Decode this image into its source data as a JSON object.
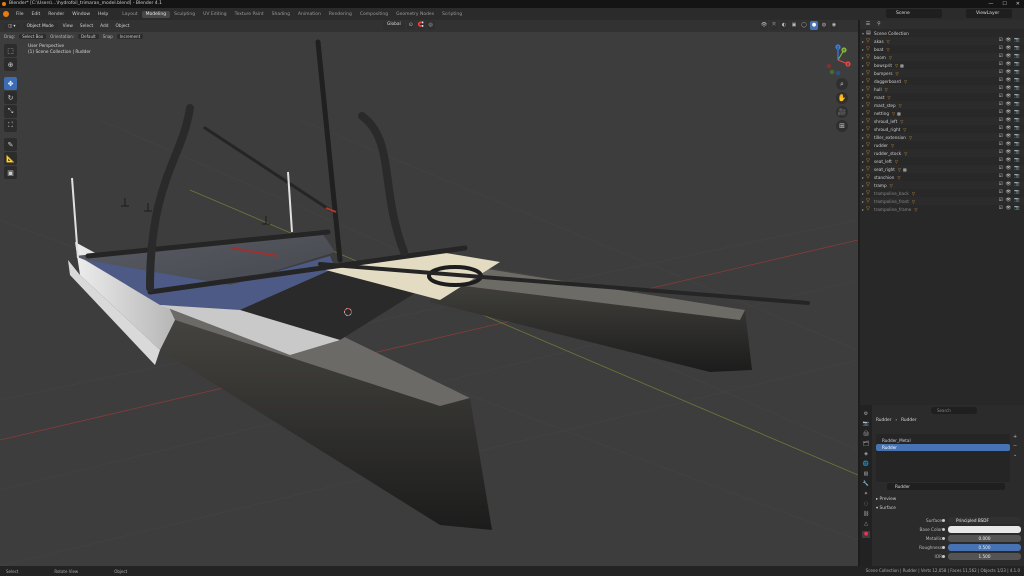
{
  "window": {
    "title": "Blender* [C:\\Users\\...\\hydrofoil_trimaran_model.blend] - Blender 4.1",
    "controls": [
      "—",
      "☐",
      "✕"
    ]
  },
  "topbar": {
    "menus": [
      "File",
      "Edit",
      "Render",
      "Window",
      "Help"
    ],
    "workspaces": [
      "Layout",
      "Modeling",
      "Sculpting",
      "UV Editing",
      "Texture Paint",
      "Shading",
      "Animation",
      "Rendering",
      "Compositing",
      "Geometry Nodes",
      "Scripting"
    ],
    "active_workspace": "Modeling",
    "scene": "Scene",
    "view_layer": "ViewLayer"
  },
  "viewport": {
    "mode": "Object Mode",
    "menus": [
      "View",
      "Select",
      "Add",
      "Object"
    ],
    "transform_orientation": "Global",
    "tool_settings": {
      "label_drag": "Drag:",
      "drag_value": "Select Box",
      "label_orient": "Orientation:",
      "orient_value": "Default",
      "label_snap": "Snap",
      "snap_value": "Increment"
    },
    "overlay_line1": "User Perspective",
    "overlay_line2": "(1) Scene Collection | Rudder",
    "gizmo_axes": [
      "X",
      "Y",
      "Z"
    ]
  },
  "outliner": {
    "root": "Scene Collection",
    "items": [
      {
        "name": "akas",
        "has_mat": false,
        "dim": false
      },
      {
        "name": "boat",
        "has_mat": false,
        "dim": false
      },
      {
        "name": "boom",
        "has_mat": false,
        "dim": false
      },
      {
        "name": "bowsprit",
        "has_mat": true,
        "dim": false
      },
      {
        "name": "bumpers",
        "has_mat": false,
        "dim": false
      },
      {
        "name": "daggerboard",
        "has_mat": false,
        "dim": false
      },
      {
        "name": "hull",
        "has_mat": false,
        "dim": false
      },
      {
        "name": "mast",
        "has_mat": false,
        "dim": false
      },
      {
        "name": "mast_step",
        "has_mat": false,
        "dim": false
      },
      {
        "name": "netting",
        "has_mat": true,
        "dim": false
      },
      {
        "name": "shroud_left",
        "has_mat": false,
        "dim": false
      },
      {
        "name": "shroud_right",
        "has_mat": false,
        "dim": false
      },
      {
        "name": "tiller_extension",
        "has_mat": false,
        "dim": false
      },
      {
        "name": "rudder",
        "has_mat": false,
        "dim": false
      },
      {
        "name": "rudder_stock",
        "has_mat": false,
        "dim": false
      },
      {
        "name": "seat_left",
        "has_mat": false,
        "dim": false
      },
      {
        "name": "seat_right",
        "has_mat": true,
        "dim": false
      },
      {
        "name": "stanchion",
        "has_mat": false,
        "dim": false
      },
      {
        "name": "tramp",
        "has_mat": false,
        "dim": false
      },
      {
        "name": "trampoline_back",
        "has_mat": false,
        "dim": true
      },
      {
        "name": "trampoline_front",
        "has_mat": false,
        "dim": true
      },
      {
        "name": "trampoline_frame",
        "has_mat": false,
        "dim": true
      }
    ]
  },
  "properties": {
    "search_placeholder": "Search",
    "breadcrumb": [
      "Rudder",
      "Rudder"
    ],
    "material_slots": [
      {
        "name": "Rudder_Metal",
        "active": false
      },
      {
        "name": "Rudder",
        "active": true
      }
    ],
    "material_name": "Rudder",
    "panels": {
      "preview": "Preview",
      "surface": "Surface"
    },
    "fields": [
      {
        "label": "Surface",
        "value": "Principled BSDF",
        "style": "dark"
      },
      {
        "label": "Base Color",
        "value": "",
        "style": "white"
      },
      {
        "label": "Metallic",
        "value": "0.000",
        "style": "grey"
      },
      {
        "label": "Roughness",
        "value": "0.500",
        "style": "blue"
      },
      {
        "label": "IOR",
        "value": "1.500",
        "style": "grey"
      }
    ]
  },
  "statusbar": {
    "items": [
      "Select",
      "Rotate View",
      "Object"
    ],
    "right": "Scene Collection | Rudder | Verts 12,058 | Faces 11,562 | Objects 1/23 | 4.1.0"
  },
  "colors": {
    "accent": "#4772b3",
    "orange": "#e87d0d",
    "viewport_bg": "#3d3d3d"
  }
}
